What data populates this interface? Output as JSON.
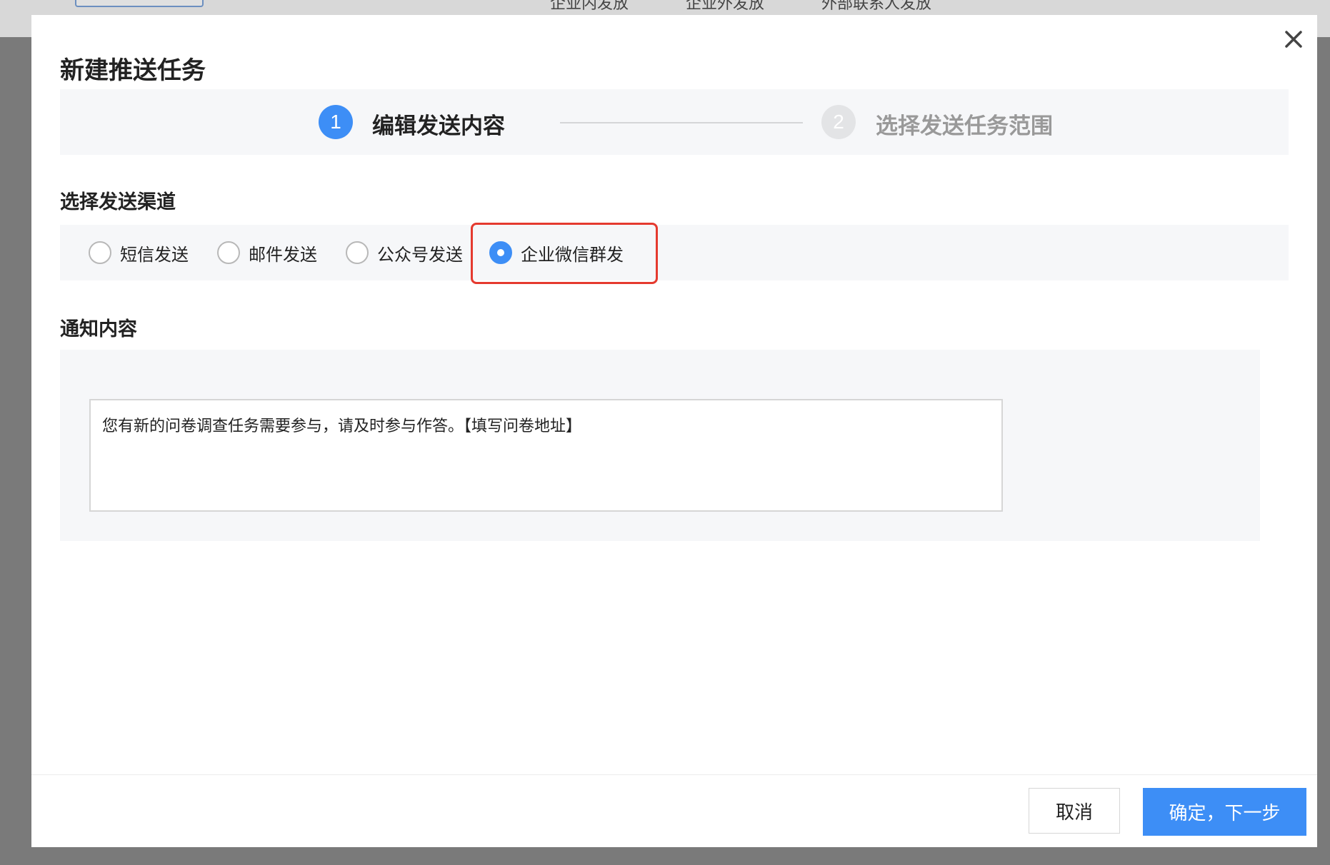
{
  "background": {
    "tabs": [
      "企业内发放",
      "企业外发放",
      "外部联系人发放"
    ]
  },
  "modal": {
    "title": "新建推送任务",
    "close_icon": "close-icon"
  },
  "steps": [
    {
      "number": "1",
      "label": "编辑发送内容",
      "state": "active"
    },
    {
      "number": "2",
      "label": "选择发送任务范围",
      "state": "inactive"
    }
  ],
  "channel": {
    "label": "选择发送渠道",
    "options": [
      {
        "label": "短信发送",
        "checked": false
      },
      {
        "label": "邮件发送",
        "checked": false
      },
      {
        "label": "公众号发送",
        "checked": false
      },
      {
        "label": "企业微信群发",
        "checked": true
      }
    ]
  },
  "notice": {
    "label": "通知内容",
    "value": "您有新的问卷调查任务需要参与，请及时参与作答。【填写问卷地址】"
  },
  "footer": {
    "cancel_label": "取消",
    "confirm_label": "确定，下一步"
  },
  "colors": {
    "primary": "#3d8ef6",
    "highlight": "#e53a2f",
    "panel_bg": "#f6f7f9"
  }
}
